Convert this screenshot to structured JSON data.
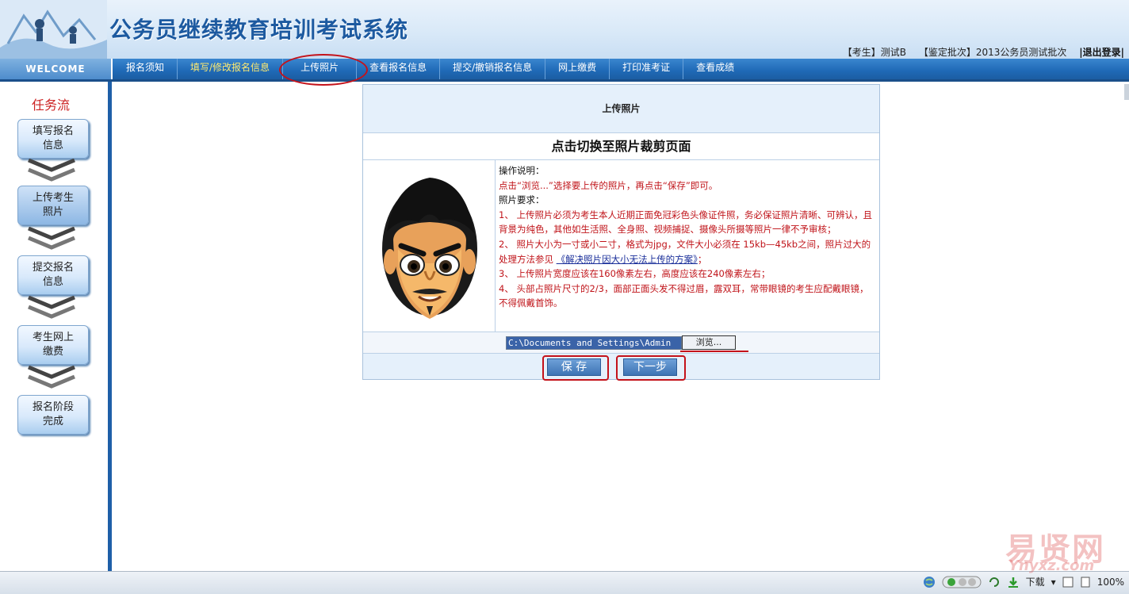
{
  "header": {
    "title": "公务员继续教育培训考试系统",
    "user_role": "【考生】测试B",
    "batch": "【鉴定批次】2013公务员测试批次",
    "logout": "|退出登录|"
  },
  "nav": {
    "welcome": "WELCOME",
    "items": [
      "报名须知",
      "填写/修改报名信息",
      "上传照片",
      "查看报名信息",
      "提交/撤销报名信息",
      "网上缴费",
      "打印准考证",
      "查看成绩"
    ]
  },
  "sidebar": {
    "title": "任务流",
    "steps": [
      "填写报名\n信息",
      "上传考生\n照片",
      "提交报名\n信息",
      "考生网上\n缴费",
      "报名阶段\n完成"
    ]
  },
  "panel": {
    "heading": "上传照片",
    "switch_link": "点击切换至照片裁剪页面",
    "instructions": {
      "op_title": "操作说明：",
      "op_text": "点击“浏览...”选择要上传的照片，再点击“保存”即可。",
      "req_title": "照片要求：",
      "req1": "1、  上传照片必须为考生本人近期正面免冠彩色头像证件照，务必保证照片清晰、可辨认，且背景为纯色，其他如生活照、全身照、视频捕捉、摄像头所摄等照片一律不予审核；",
      "req2_a": "2、  照片大小为一寸或小二寸，格式为jpg，文件大小必须在 15kb—45kb之间，照片过大的处理方法参见",
      "req2_link": "《解决照片因大小无法上传的方案》",
      "req2_b": "；",
      "req3": "3、  上传照片宽度应该在160像素左右，高度应该在240像素左右；",
      "req4": "4、  头部占照片尺寸的2/3，面部正面头发不得过眉，露双耳，常带眼镜的考生应配戴眼镜，不得佩戴首饰。"
    },
    "file_value": "C:\\Documents and Settings\\Admin",
    "browse_label": "浏览...",
    "save_label": "保 存",
    "next_label": "下一步"
  },
  "statusbar": {
    "download": "下载",
    "zoom": "100%"
  },
  "watermark": {
    "text": "易贤网",
    "url": "Ynyxz.com"
  },
  "colors": {
    "accent": "#1f69b6",
    "highlight": "#c4121a",
    "nav_active": "#ffea70"
  }
}
